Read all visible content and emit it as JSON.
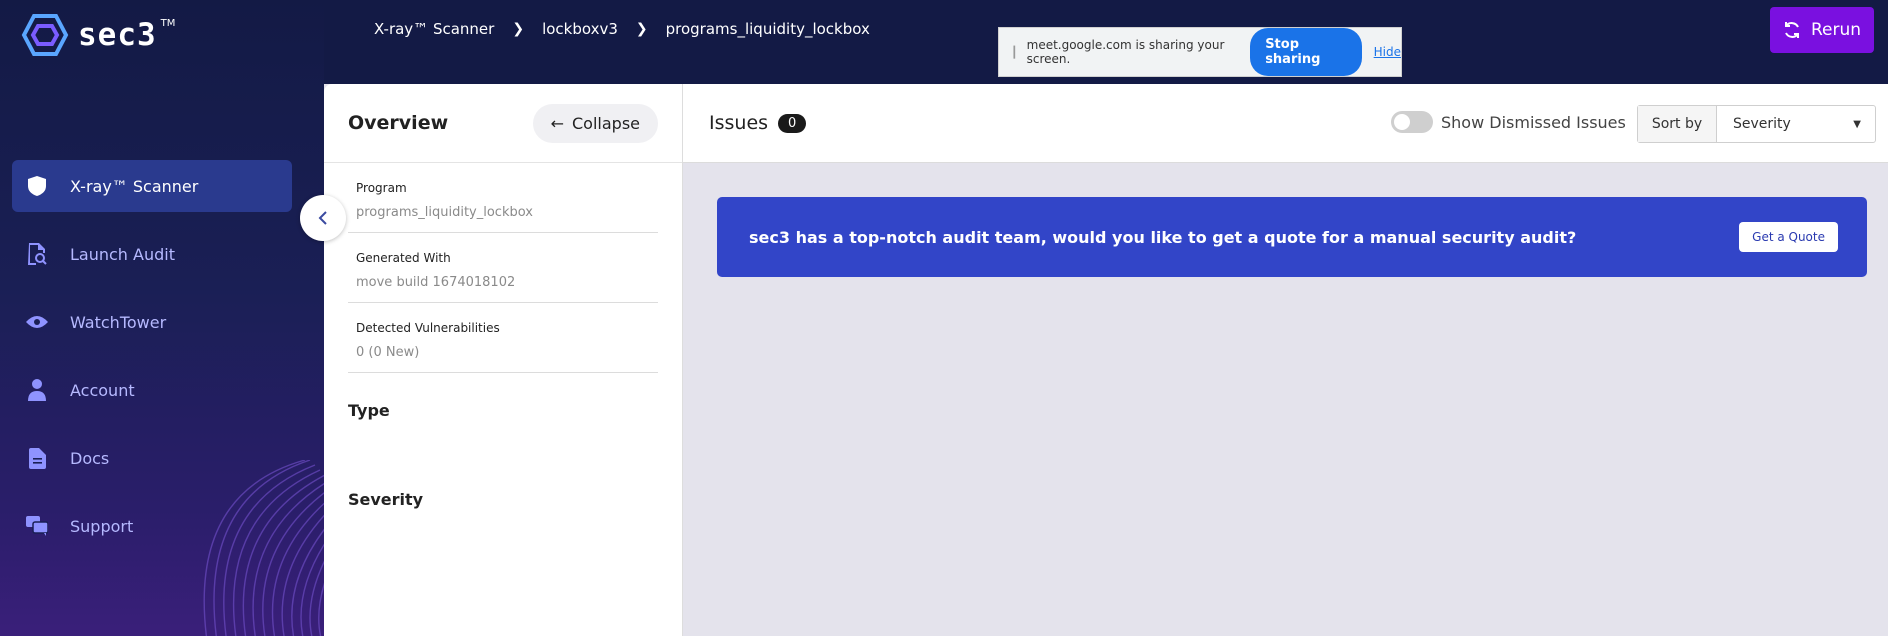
{
  "brand": {
    "name": "sec3",
    "tm": "TM"
  },
  "sidebar": {
    "items": [
      {
        "label": "X-ray™ Scanner",
        "icon": "shield-icon",
        "active": true
      },
      {
        "label": "Launch Audit",
        "icon": "audit-icon",
        "active": false
      },
      {
        "label": "WatchTower",
        "icon": "eye-icon",
        "active": false
      },
      {
        "label": "Account",
        "icon": "user-icon",
        "active": false
      },
      {
        "label": "Docs",
        "icon": "document-icon",
        "active": false
      },
      {
        "label": "Support",
        "icon": "chat-icon",
        "active": false
      }
    ]
  },
  "breadcrumb": [
    "X-ray™ Scanner",
    "lockboxv3",
    "programs_liquidity_lockbox"
  ],
  "screen_share": {
    "message": "meet.google.com is sharing your screen.",
    "stop_label": "Stop sharing",
    "hide_label": "Hide"
  },
  "rerun_label": "Rerun",
  "overview": {
    "title": "Overview",
    "collapse_label": "Collapse",
    "fields": [
      {
        "label": "Program",
        "value": "programs_liquidity_lockbox"
      },
      {
        "label": "Generated With",
        "value": "move build 1674018102"
      },
      {
        "label": "Detected Vulnerabilities",
        "value": "0 (0 New)"
      }
    ],
    "sections": [
      "Type",
      "Severity"
    ]
  },
  "issues": {
    "title": "Issues",
    "count": "0",
    "toggle_label": "Show Dismissed Issues",
    "sort_label": "Sort by",
    "sort_value": "Severity"
  },
  "banner": {
    "text": "sec3 has a top-notch audit team, would you like to get a quote for a manual security audit?",
    "button_label": "Get a Quote"
  },
  "colors": {
    "sidebar_bg": "#131a45",
    "accent": "#7a10e0",
    "banner": "#3245c8",
    "active_nav": "#2a3a8e"
  }
}
